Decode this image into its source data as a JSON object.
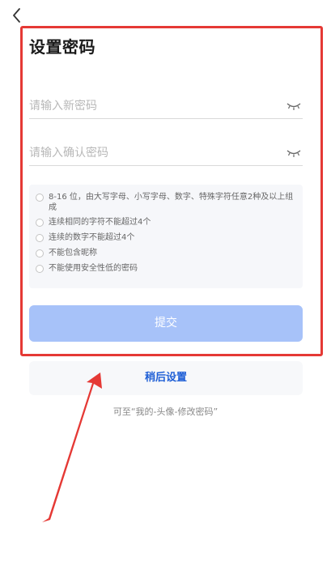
{
  "header": {
    "back_icon": "chevron-left-icon",
    "title": "设置密码"
  },
  "form": {
    "new_password": {
      "placeholder": "请输入新密码",
      "value": "",
      "toggle_icon": "eye-closed-icon"
    },
    "confirm_password": {
      "placeholder": "请输入确认密码",
      "value": "",
      "toggle_icon": "eye-closed-icon"
    }
  },
  "rules": [
    "8-16 位，由大写字母、小写字母、数字、特殊字符任意2种及以上组成",
    "连续相同的字符不能超过4个",
    "连续的数字不能超过4个",
    "不能包含昵称",
    "不能使用安全性低的密码"
  ],
  "actions": {
    "submit_label": "提交",
    "later_label": "稍后设置"
  },
  "hint": "可至“我的-头像-修改密码”",
  "colors": {
    "highlight_border": "#e53935",
    "submit_bg": "#a7c2f9",
    "link_blue": "#1f5fd6"
  }
}
